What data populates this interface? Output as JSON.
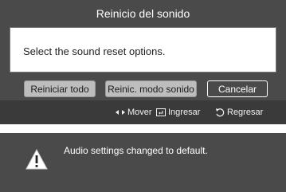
{
  "dialog": {
    "title": "Reinicio del sonido",
    "message": "Select the sound reset options.",
    "buttons": {
      "reset_all": "Reiniciar todo",
      "reset_mode": "Reinic. modo sonido",
      "cancel": "Cancelar"
    }
  },
  "hints": {
    "move": "Mover",
    "enter": "Ingresar",
    "return": "Regresar"
  },
  "notice": {
    "message": "Audio settings changed to default.",
    "icon": "warning-icon"
  },
  "colors": {
    "panel_bg": "#4a4a4a",
    "hint_bg": "#3a3a3a",
    "button_bg": "#bdbdbd",
    "warning_fill": "#ffffff"
  }
}
